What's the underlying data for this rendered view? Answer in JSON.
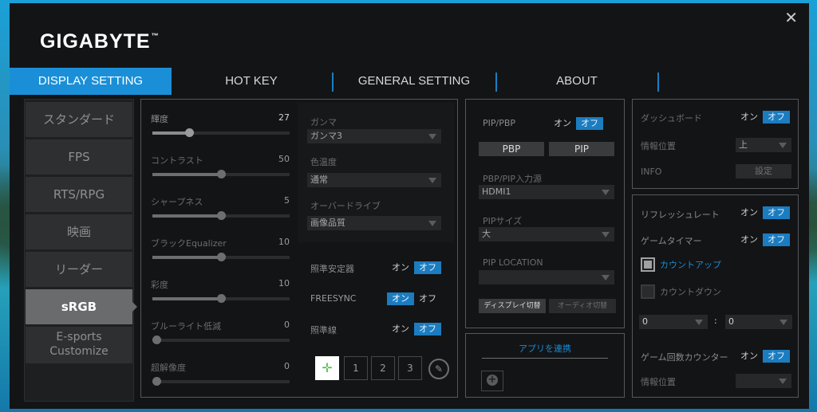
{
  "brand": {
    "logo": "GIGABYTE",
    "tm": "™"
  },
  "tabs": [
    "DISPLAY SETTING",
    "HOT KEY",
    "GENERAL SETTING",
    "ABOUT"
  ],
  "nav": [
    "スタンダード",
    "FPS",
    "RTS/RPG",
    "映画",
    "リーダー",
    "sRGB",
    "E-sports",
    "Customize"
  ],
  "picture": {
    "sliders": [
      {
        "label": "輝度",
        "value": "27",
        "level": 0.27
      },
      {
        "label": "コントラスト",
        "value": "50",
        "level": 0.5
      },
      {
        "label": "シャープネス",
        "value": "5",
        "level": 0.5
      },
      {
        "label": "ブラックEqualizer",
        "value": "10",
        "level": 0.5
      },
      {
        "label": "彩度",
        "value": "10",
        "level": 0.5
      },
      {
        "label": "ブルーライト低減",
        "value": "0",
        "level": 0.0
      },
      {
        "label": "超解像度",
        "value": "0",
        "level": 0.0
      }
    ],
    "gamma_label": "ガンマ",
    "gamma_value": "ガンマ3",
    "temp_label": "色温度",
    "temp_value": "通常",
    "od_label": "オーバードライブ",
    "od_value": "画像品質",
    "aim_stab": "照準安定器",
    "freesync": "FREESYNC",
    "crosshair": "照準線",
    "on": "オン",
    "off": "オフ",
    "crosshair_buttons": [
      "1",
      "2",
      "3"
    ]
  },
  "pip": {
    "pip_pbp": "PIP/PBP",
    "pbp_btn": "PBP",
    "pip_btn": "PIP",
    "source_label": "PBP/PIP入力源",
    "source_value": "HDMI1",
    "size_label": "PIPサイズ",
    "size_value": "大",
    "loc_label": "PIP LOCATION",
    "loc_value": "",
    "display_switch": "ディスプレイ切替",
    "audio_switch": "オーディオ切替"
  },
  "apps": {
    "link_label": "アプリを連携",
    "add_icon": "+"
  },
  "dashboard": {
    "dashboard": "ダッシュボード",
    "info_pos": "情報位置",
    "info_pos_value": "上",
    "info": "INFO",
    "settings": "設定"
  },
  "gaming": {
    "refresh": "リフレッシュレート",
    "timer": "ゲームタイマー",
    "count_up": "カウントアップ",
    "count_down": "カウントダウン",
    "min": "0",
    "sec": "0",
    "colon": ":",
    "counter": "ゲーム回数カウンター",
    "counter_pos": "情報位置"
  },
  "colors": {
    "accent": "#1b7cc0",
    "tab_active": "#1a8fd8",
    "bg": "#131416"
  }
}
